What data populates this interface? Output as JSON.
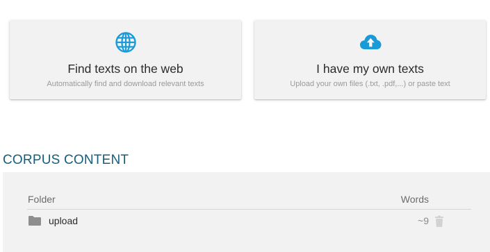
{
  "cards": [
    {
      "title": "Find texts on the web",
      "subtitle": "Automatically find and download relevant texts",
      "icon": "globe-icon",
      "icon_color": "#1a9bd7"
    },
    {
      "title": "I have my own texts",
      "subtitle": "Upload your own files (.txt, .pdf,...) or paste text",
      "icon": "cloud-upload-icon",
      "icon_color": "#1a9bd7"
    }
  ],
  "corpus": {
    "heading": "CORPUS CONTENT",
    "heading_color": "#145e7d",
    "columns": {
      "folder": "Folder",
      "words": "Words"
    },
    "rows": [
      {
        "name": "upload",
        "words": "~9",
        "icon": "folder-icon",
        "action_icon": "trash-icon"
      }
    ]
  }
}
